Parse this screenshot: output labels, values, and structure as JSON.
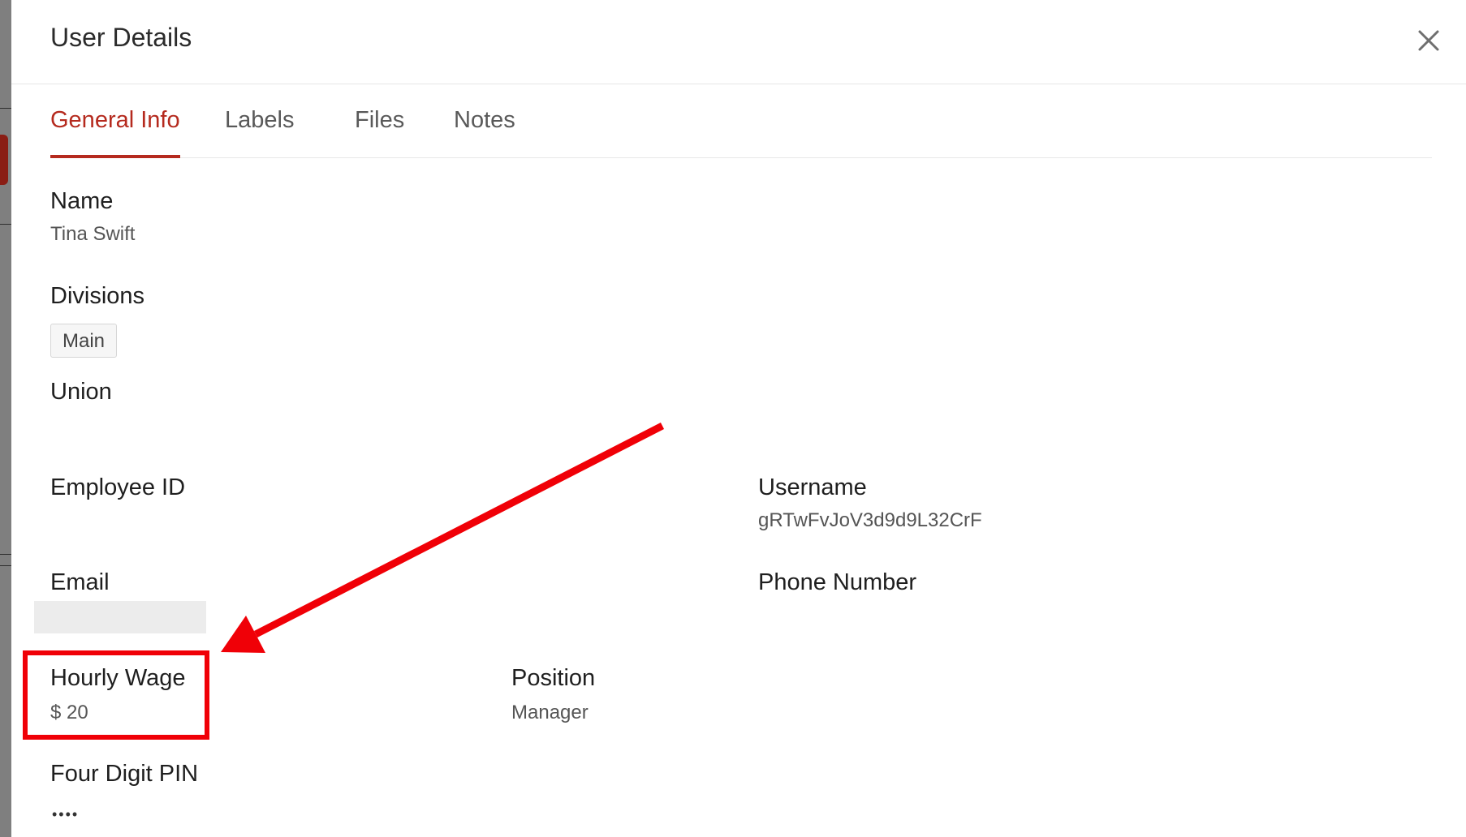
{
  "modal": {
    "title": "User Details",
    "close_icon": "close-icon"
  },
  "tabs": [
    {
      "label": "General Info",
      "active": true
    },
    {
      "label": "Labels",
      "active": false
    },
    {
      "label": "Files",
      "active": false
    },
    {
      "label": "Notes",
      "active": false
    }
  ],
  "fields": {
    "name": {
      "label": "Name",
      "value": "Tina Swift"
    },
    "divisions": {
      "label": "Divisions",
      "chips": [
        "Main"
      ]
    },
    "union": {
      "label": "Union",
      "value": ""
    },
    "employee_id": {
      "label": "Employee ID",
      "value": ""
    },
    "username": {
      "label": "Username",
      "value": "gRTwFvJoV3d9d9L32CrF"
    },
    "email": {
      "label": "Email",
      "value": ""
    },
    "phone": {
      "label": "Phone Number",
      "value": ""
    },
    "hourly_wage": {
      "label": "Hourly Wage",
      "value": "$ 20"
    },
    "position": {
      "label": "Position",
      "value": "Manager"
    },
    "pin": {
      "label": "Four Digit PIN",
      "value": "••••"
    }
  },
  "colors": {
    "accent": "#b52a1e",
    "annotation": "#f00007"
  }
}
